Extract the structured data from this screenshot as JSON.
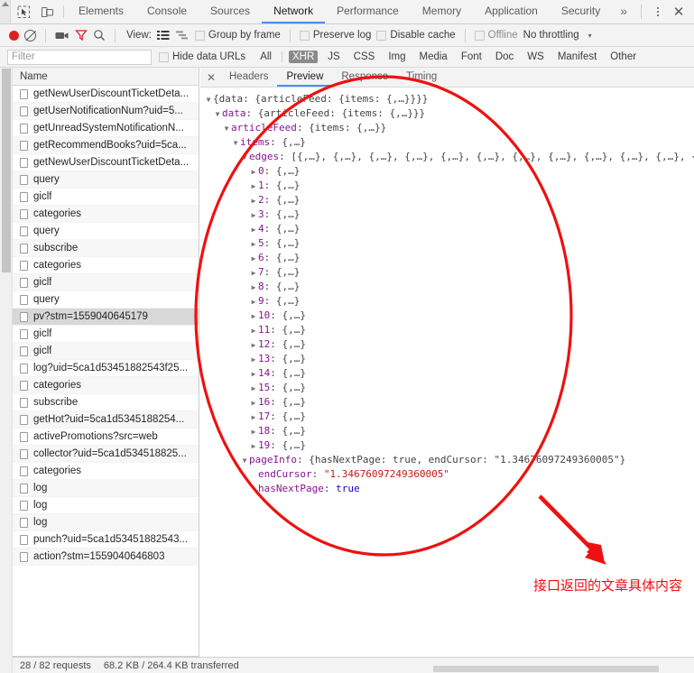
{
  "window": {
    "tabbar": {
      "inspect_icon": "inspect-cursor-icon",
      "device_icon": "device-toolbar-icon",
      "tabs": [
        {
          "label": "Elements",
          "active": false
        },
        {
          "label": "Console",
          "active": false
        },
        {
          "label": "Sources",
          "active": false
        },
        {
          "label": "Network",
          "active": true
        },
        {
          "label": "Performance",
          "active": false
        },
        {
          "label": "Memory",
          "active": false
        },
        {
          "label": "Application",
          "active": false
        },
        {
          "label": "Security",
          "active": false
        }
      ],
      "more_label": "»",
      "menu_icon": "kebab-menu-icon",
      "close_icon": "close-icon"
    },
    "network_toolbar": {
      "record_icon": "record-dot-icon",
      "clear_icon": "clear-circle-slash-icon",
      "camera_icon": "camera-icon",
      "filter_icon": "filter-funnel-icon",
      "search_icon": "search-magnifier-icon",
      "view_label": "View:",
      "view_list_icon": "view-list-icon",
      "view_waterfall_icon": "view-waterfall-icon",
      "group_by_frame": "Group by frame",
      "preserve_log": "Preserve log",
      "disable_cache": "Disable cache",
      "offline": "Offline",
      "throttling": "No throttling",
      "throttling_chevron": "▾"
    },
    "filter_row": {
      "filter_placeholder": "Filter",
      "filter_value": "",
      "hide_data_urls": "Hide data URLs",
      "types": [
        "All",
        "XHR",
        "JS",
        "CSS",
        "Img",
        "Media",
        "Font",
        "Doc",
        "WS",
        "Manifest",
        "Other"
      ],
      "active_type": "XHR"
    }
  },
  "request_list": {
    "header": "Name",
    "selected_index": 13,
    "items": [
      "getNewUserDiscountTicketDeta...",
      "getUserNotificationNum?uid=5...",
      "getUnreadSystemNotificationN...",
      "getRecommendBooks?uid=5ca...",
      "getNewUserDiscountTicketDeta...",
      "query",
      "giclf",
      "categories",
      "query",
      "subscribe",
      "categories",
      "giclf",
      "query",
      "pv?stm=1559040645179",
      "giclf",
      "giclf",
      "log?uid=5ca1d53451882543f25...",
      "categories",
      "subscribe",
      "getHot?uid=5ca1d5345188254...",
      "activePromotions?src=web",
      "collector?uid=5ca1d534518825...",
      "categories",
      "log",
      "log",
      "log",
      "punch?uid=5ca1d53451882543...",
      "action?stm=1559040646803"
    ]
  },
  "detail_panel": {
    "close_icon": "close-icon",
    "tabs": [
      {
        "label": "Headers",
        "active": false
      },
      {
        "label": "Preview",
        "active": true
      },
      {
        "label": "Response",
        "active": false
      },
      {
        "label": "Timing",
        "active": false
      }
    ],
    "preview_tree": {
      "root": "{data: {articleFeed: {items: {,…}}}}",
      "level1_key": "data",
      "level1_val": "{articleFeed: {items: {,…}}}",
      "level2_key": "articleFeed",
      "level2_val": "{items: {,…}}",
      "level3_key": "items",
      "level3_val": "{,…}",
      "edges_key": "edges",
      "edges_val": "[{,…}, {,…}, {,…}, {,…}, {,…}, {,…}, {,…}, {,…}, {,…}, {,…}, {,…}, {,…}, {,…}",
      "edge_value": "{,…}",
      "edge_indices": [
        "0",
        "1",
        "2",
        "3",
        "4",
        "5",
        "6",
        "7",
        "8",
        "9",
        "10",
        "11",
        "12",
        "13",
        "14",
        "15",
        "16",
        "17",
        "18",
        "19"
      ],
      "pageinfo_key": "pageInfo",
      "pageinfo_val": "{hasNextPage: true, endCursor: \"1.34676097249360005\"}",
      "endcursor_key": "endCursor",
      "endcursor_val": "\"1.34676097249360005\"",
      "hasnextpage_key": "hasNextPage",
      "hasnextpage_val": "true"
    }
  },
  "annotation": {
    "text": "接口返回的文章具体内容",
    "color": "#f01010",
    "ellipse_name": "red-ellipse-highlight",
    "arrow_name": "red-arrow-pointer"
  },
  "status_bar": {
    "requests": "28 / 82 requests",
    "transferred": "68.2 KB / 264.4 KB transferred"
  }
}
